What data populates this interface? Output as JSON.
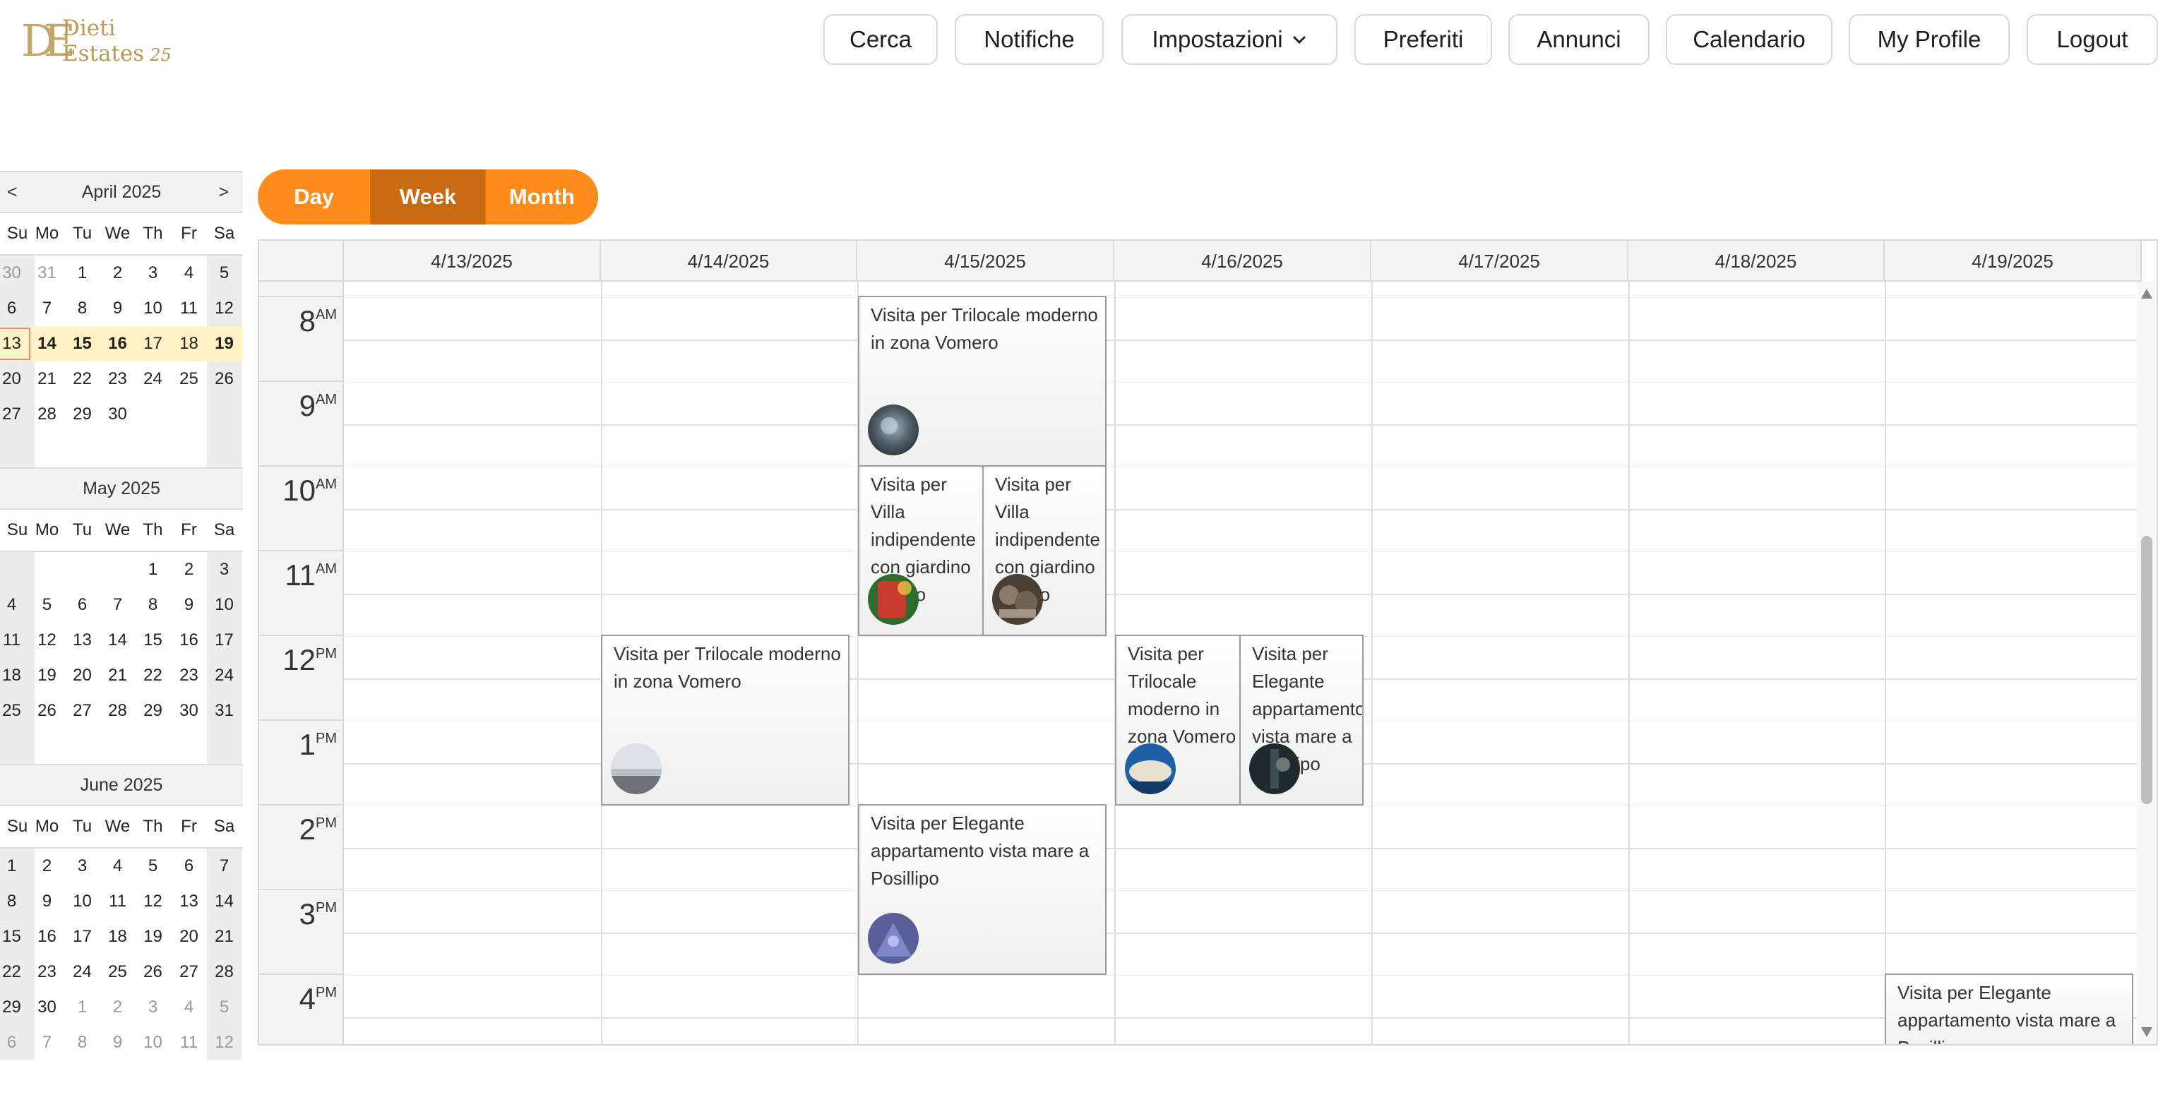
{
  "brand": {
    "monogram": "DE",
    "line1": "Dieti",
    "line2": "Estates",
    "suffix": "25"
  },
  "nav": {
    "cerca": "Cerca",
    "notifiche": "Notifiche",
    "impostazioni": "Impostazioni",
    "preferiti": "Preferiti",
    "annunci": "Annunci",
    "calendario": "Calendario",
    "profile": "My Profile",
    "logout": "Logout"
  },
  "mini_calendars": [
    {
      "title": "April 2025",
      "prev": "<",
      "next": ">",
      "dow": [
        "Su",
        "Mo",
        "Tu",
        "We",
        "Th",
        "Fr",
        "Sa"
      ],
      "weeks": [
        [
          "30",
          "31",
          "1",
          "2",
          "3",
          "4",
          "5"
        ],
        [
          "6",
          "7",
          "8",
          "9",
          "10",
          "11",
          "12"
        ],
        [
          "13",
          "14",
          "15",
          "16",
          "17",
          "18",
          "19"
        ],
        [
          "20",
          "21",
          "22",
          "23",
          "24",
          "25",
          "26"
        ],
        [
          "27",
          "28",
          "29",
          "30",
          "",
          "",
          ""
        ]
      ]
    },
    {
      "title": "May 2025",
      "dow": [
        "Su",
        "Mo",
        "Tu",
        "We",
        "Th",
        "Fr",
        "Sa"
      ],
      "weeks": [
        [
          "",
          "",
          "",
          "",
          "1",
          "2",
          "3"
        ],
        [
          "4",
          "5",
          "6",
          "7",
          "8",
          "9",
          "10"
        ],
        [
          "11",
          "12",
          "13",
          "14",
          "15",
          "16",
          "17"
        ],
        [
          "18",
          "19",
          "20",
          "21",
          "22",
          "23",
          "24"
        ],
        [
          "25",
          "26",
          "27",
          "28",
          "29",
          "30",
          "31"
        ]
      ]
    },
    {
      "title": "June 2025",
      "dow": [
        "Su",
        "Mo",
        "Tu",
        "We",
        "Th",
        "Fr",
        "Sa"
      ],
      "weeks": [
        [
          "1",
          "2",
          "3",
          "4",
          "5",
          "6",
          "7"
        ],
        [
          "8",
          "9",
          "10",
          "11",
          "12",
          "13",
          "14"
        ],
        [
          "15",
          "16",
          "17",
          "18",
          "19",
          "20",
          "21"
        ],
        [
          "22",
          "23",
          "24",
          "25",
          "26",
          "27",
          "28"
        ],
        [
          "29",
          "30",
          "1",
          "2",
          "3",
          "4",
          "5"
        ],
        [
          "6",
          "7",
          "8",
          "9",
          "10",
          "11",
          "12"
        ]
      ]
    }
  ],
  "views": {
    "day": "Day",
    "week": "Week",
    "month": "Month",
    "active": "Week"
  },
  "week": {
    "days": [
      "4/13/2025",
      "4/14/2025",
      "4/15/2025",
      "4/16/2025",
      "4/17/2025",
      "4/18/2025",
      "4/19/2025"
    ],
    "hours": [
      {
        "n": "8",
        "ap": "AM"
      },
      {
        "n": "9",
        "ap": "AM"
      },
      {
        "n": "10",
        "ap": "AM"
      },
      {
        "n": "11",
        "ap": "AM"
      },
      {
        "n": "12",
        "ap": "PM"
      },
      {
        "n": "1",
        "ap": "PM"
      },
      {
        "n": "2",
        "ap": "PM"
      },
      {
        "n": "3",
        "ap": "PM"
      },
      {
        "n": "4",
        "ap": "PM"
      }
    ]
  },
  "events": [
    {
      "title": "Visita per Trilocale moderno in zona Vomero",
      "day": "4/15/2025",
      "start": "8 AM",
      "end": "10 AM"
    },
    {
      "title": "Visita per Villa indipendente con giardino privato",
      "day": "4/15/2025",
      "start": "10 AM",
      "end": "12 PM"
    },
    {
      "title": "Visita per Villa indipendente con giardino privato",
      "day": "4/15/2025",
      "start": "10 AM",
      "end": "12 PM"
    },
    {
      "title": "Visita per Trilocale moderno in zona Vomero",
      "day": "4/14/2025",
      "start": "12 PM",
      "end": "2 PM"
    },
    {
      "title": "Visita per Trilocale moderno in zona Vomero",
      "day": "4/16/2025",
      "start": "12 PM",
      "end": "2 PM"
    },
    {
      "title": "Visita per Elegante appartamento vista mare a Posillipo",
      "day": "4/16/2025",
      "start": "12 PM",
      "end": "2 PM"
    },
    {
      "title": "Visita per Elegante appartamento vista mare a Posillipo",
      "day": "4/15/2025",
      "start": "2 PM",
      "end": "4 PM"
    },
    {
      "title": "Visita per Elegante appartamento vista mare a Posillipo",
      "day": "4/19/2025",
      "start": "4 PM",
      "end": ""
    }
  ],
  "colors": {
    "accent": "#ff8c1a",
    "accent_active": "#c86a12",
    "brand_gold": "#b79a55",
    "selected_week": "#fff3c6"
  }
}
